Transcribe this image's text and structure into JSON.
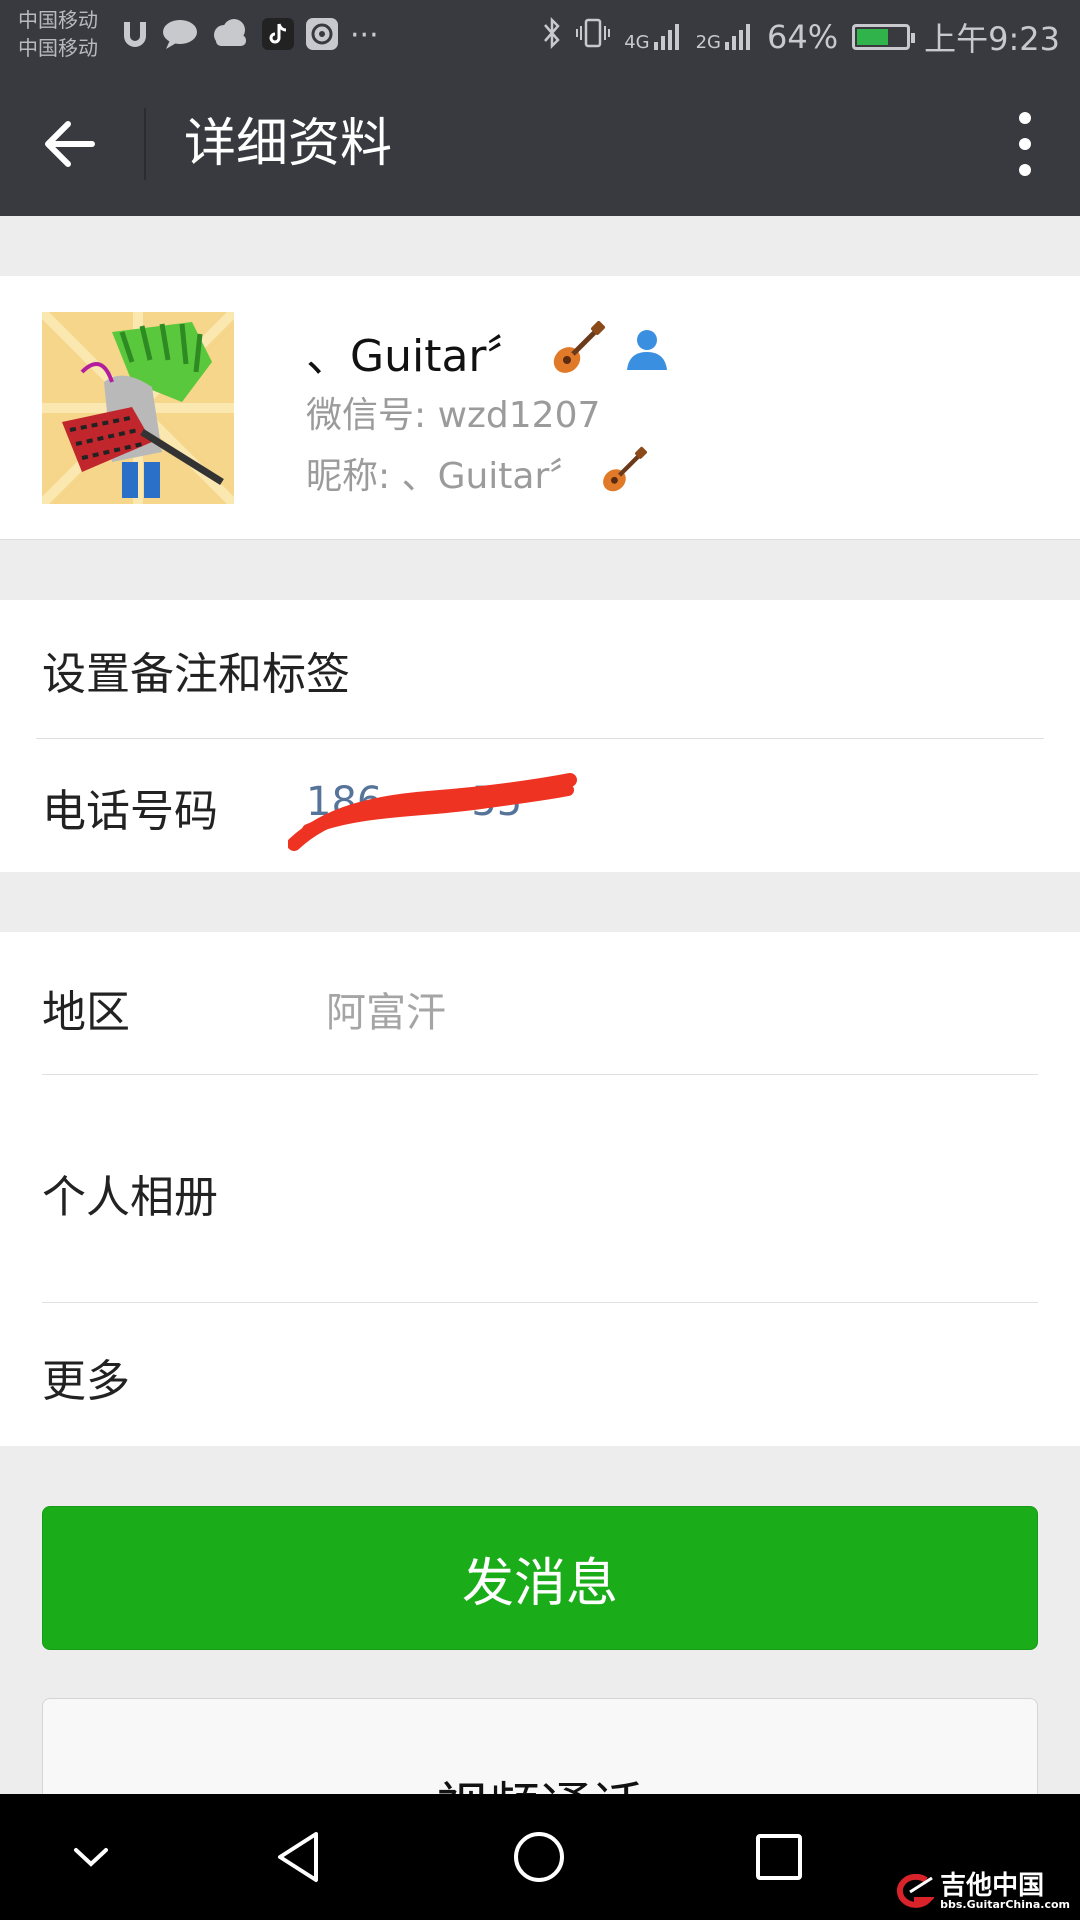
{
  "status_bar": {
    "carrier_1": "中国移动",
    "carrier_2": "中国移动",
    "left_icons": [
      "notification-icon",
      "chat-bubble-icon",
      "cloud-icon",
      "tiktok-icon",
      "circle-app-icon"
    ],
    "overflow": "···",
    "network_1": "4G",
    "network_2": "2G",
    "battery_percent": "64%",
    "battery_level": 0.64,
    "time": "上午9:23"
  },
  "action_bar": {
    "title": "详细资料"
  },
  "profile": {
    "name": "、Guitar〞",
    "wechat_id": "微信号: wzd1207",
    "nickname": "昵称: 、Guitar〞"
  },
  "rows": {
    "remark_label": "设置备注和标签",
    "phone_label": "电话号码",
    "phone_value": "186·······55",
    "region_label": "地区",
    "region_value": "阿富汗",
    "album_label": "个人相册",
    "more_label": "更多"
  },
  "buttons": {
    "send_message": "发消息",
    "video_call": "视频通话"
  },
  "watermark": {
    "title": "吉他中国",
    "url": "bbs.GuitarChina.com"
  },
  "colors": {
    "header_bg": "#393a3f",
    "accent_green": "#1aad19",
    "link_blue": "#56739a",
    "scribble_red": "#ee3322"
  }
}
